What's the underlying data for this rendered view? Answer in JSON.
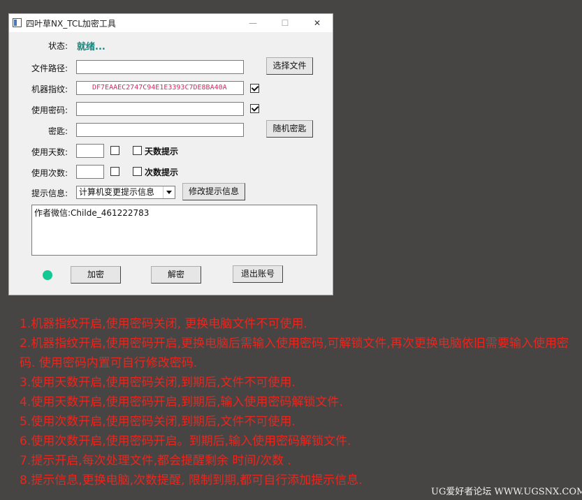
{
  "window": {
    "title": "四叶草NX_TCL加密工具",
    "minimize_glyph": "—",
    "maximize_glyph": "☐",
    "close_glyph": "✕"
  },
  "form": {
    "status_label": "状态:",
    "status_value": "就绪...",
    "file_path_label": "文件路径:",
    "file_path_value": "",
    "select_file_button": "选择文件",
    "machine_fp_label": "机器指纹:",
    "machine_fp_value": "DF7EAAEC2747C94E1E3393C7DE8BA40A",
    "machine_fp_checked": true,
    "use_password_label": "使用密码:",
    "use_password_value": "",
    "use_password_checked": true,
    "key_label": "密匙:",
    "key_value": "",
    "random_key_button": "随机密匙",
    "days_label": "使用天数:",
    "days_value": "",
    "days_checked": false,
    "days_hint_label": "天数提示",
    "days_hint_checked": false,
    "count_label": "使用次数:",
    "count_value": "",
    "count_checked": false,
    "count_hint_label": "次数提示",
    "count_hint_checked": false,
    "hint_label": "提示信息:",
    "hint_selected": "计算机变更提示信息",
    "modify_hint_button": "修改提示信息",
    "log_text": "作者微信:Childe_461222783",
    "encrypt_button": "加密",
    "decrypt_button": "解密",
    "logout_button": "退出账号",
    "indicator_color": "#12c993"
  },
  "notes": [
    "1.机器指纹开启,使用密码关闭, 更换电脑文件不可使用.",
    "2.机器指纹开启,使用密码开启,更换电脑后需输入使用密码,可解锁文件,再次更换电脑依旧需要输入使用密码. 使用密码内置可自行修改密码.",
    "3.使用天数开启,使用密码关闭,到期后,文件不可使用.",
    "4.使用天数开启,使用密码开启,到期后,输入使用密码解锁文件.",
    "5.使用次数开启,使用密码关闭,到期后,文件不可使用.",
    "6.使用次数开启,使用密码开启。到期后,输入使用密码解锁文件.",
    "7.提示开启,每次处理文件,都会提醒剩余 时间/次数 .",
    "8.提示信息,更换电脑,次数提醒, 限制到期,都可自行添加提示信息."
  ],
  "watermark": "UG爱好者论坛 WWW.UGSNX.COM"
}
